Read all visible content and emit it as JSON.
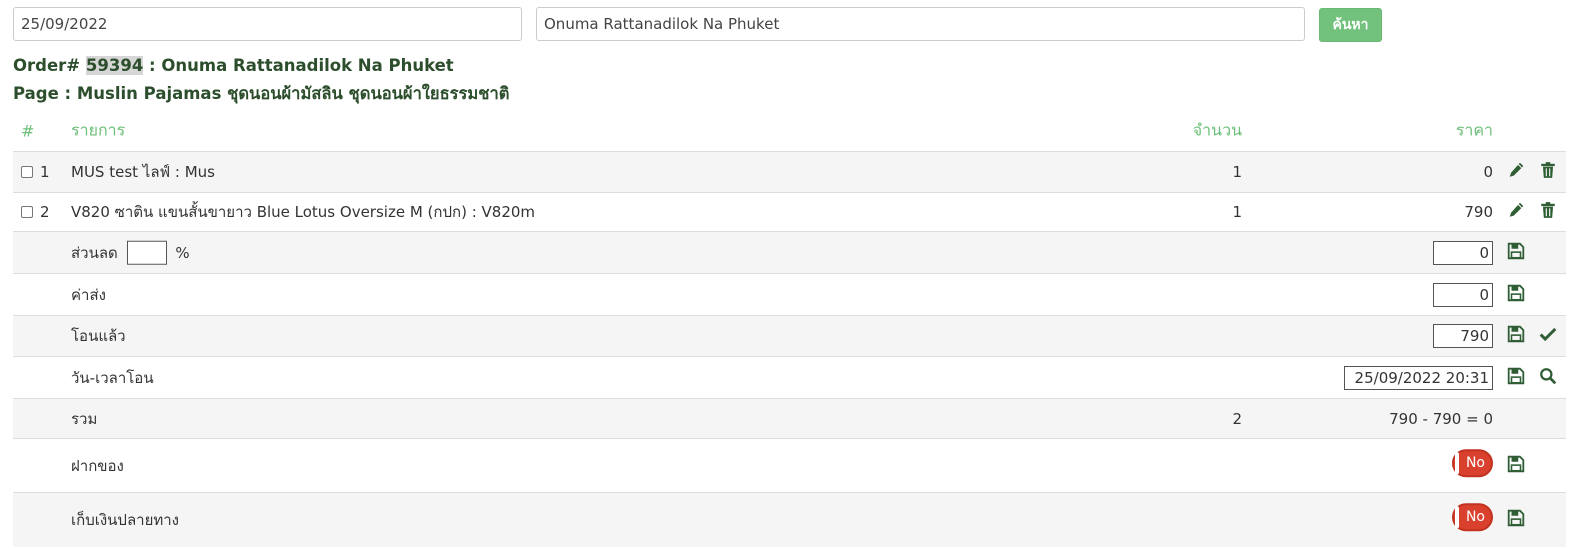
{
  "search": {
    "date_value": "25/09/2022",
    "name_value": "Onuma Rattanadilok Na Phuket",
    "button_label": "ค้นหา"
  },
  "order": {
    "prefix": "Order#",
    "number": "59394",
    "separator": ":",
    "customer": "Onuma Rattanadilok Na Phuket",
    "page_line": "Page : Muslin Pajamas ชุดนอนผ้ามัสลิน ชุดนอนผ้าใยธรรมชาติ"
  },
  "table": {
    "headers": {
      "num": "#",
      "item": "รายการ",
      "qty": "จำนวน",
      "price": "ราคา"
    },
    "items": [
      {
        "num": "1",
        "name": "MUS test ไลฟ์ : Mus",
        "qty": "1",
        "price": "0"
      },
      {
        "num": "2",
        "name": "V820 ซาติน แขนสั้นขายาว Blue Lotus Oversize M (กปก) : V820m",
        "qty": "1",
        "price": "790"
      }
    ],
    "discount": {
      "label": "ส่วนลด",
      "percent_value": "",
      "percent_sign": "%",
      "value": "0"
    },
    "shipping": {
      "label": "ค่าส่ง",
      "value": "0"
    },
    "transferred": {
      "label": "โอนแล้ว",
      "value": "790"
    },
    "transfer_time": {
      "label": "วัน-เวลาโอน",
      "value": "25/09/2022 20:31"
    },
    "total": {
      "label": "รวม",
      "qty": "2",
      "summary": "790 - 790 = 0"
    },
    "deposit": {
      "label": "ฝากของ",
      "toggle": "No"
    },
    "cod": {
      "label": "เก็บเงินปลายทาง",
      "toggle": "No"
    }
  },
  "colors": {
    "accent_green": "#72c27d",
    "header_green": "#6cbf78",
    "title_green": "#2c4e2c",
    "icon_green": "#2f5d34",
    "toggle_red": "#d9412e"
  },
  "icons": {
    "edit": "pencil-icon",
    "delete": "trash-icon",
    "save": "floppy-disk-icon",
    "confirm": "checkmark-icon",
    "search": "magnifier-icon"
  }
}
